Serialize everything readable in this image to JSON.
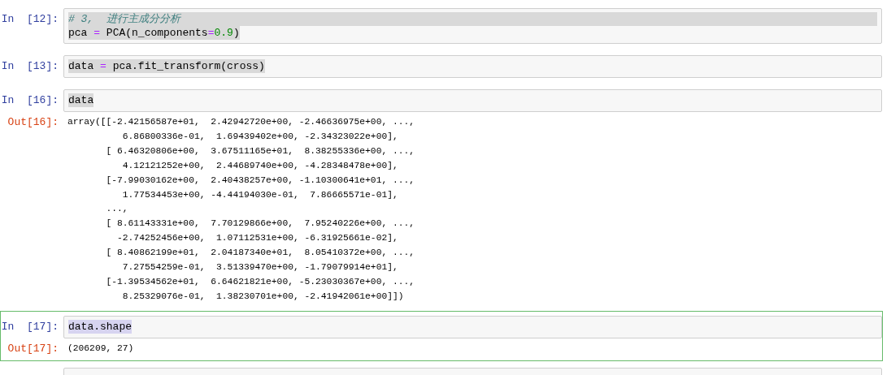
{
  "cells": [
    {
      "prompt": "In  [12]:",
      "selected": false,
      "input": [
        {
          "full_line": true,
          "tokens": [
            {
              "kind": "comment",
              "text": "# 3,  进行主成分分析"
            }
          ]
        },
        {
          "full_line": false,
          "tokens": [
            {
              "kind": "name",
              "text": "pca "
            },
            {
              "kind": "op",
              "text": "="
            },
            {
              "kind": "name",
              "text": " PCA(n_components"
            },
            {
              "kind": "op",
              "text": "="
            },
            {
              "kind": "number",
              "text": "0.9"
            },
            {
              "kind": "name",
              "text": ")"
            }
          ]
        }
      ]
    },
    {
      "prompt": "In  [13]:",
      "selected": false,
      "input": [
        {
          "full_line": false,
          "tokens": [
            {
              "kind": "name",
              "text": "data "
            },
            {
              "kind": "op",
              "text": "="
            },
            {
              "kind": "name",
              "text": " pca.fit_transform(cross)"
            }
          ]
        }
      ]
    },
    {
      "prompt": "In  [16]:",
      "selected": false,
      "input": [
        {
          "full_line": false,
          "tokens": [
            {
              "kind": "name",
              "text": "data"
            }
          ]
        }
      ],
      "output_prompt": "Out[16]:",
      "output": [
        "array([[-2.42156587e+01,  2.42942720e+00, -2.46636975e+00, ...,",
        "          6.86800336e-01,  1.69439402e+00, -2.34323022e+00],",
        "       [ 6.46320806e+00,  3.67511165e+01,  8.38255336e+00, ...,",
        "          4.12121252e+00,  2.44689740e+00, -4.28348478e+00],",
        "       [-7.99030162e+00,  2.40438257e+00, -1.10300641e+01, ...,",
        "          1.77534453e+00, -4.44194030e-01,  7.86665571e-01],",
        "       ...,",
        "       [ 8.61143331e+00,  7.70129866e+00,  7.95240226e+00, ...,",
        "         -2.74252456e+00,  1.07112531e+00, -6.31925661e-02],",
        "       [ 8.40862199e+01,  2.04187340e+01,  8.05410372e+00, ...,",
        "          7.27554259e-01,  3.51339470e+00, -1.79079914e+01],",
        "       [-1.39534562e+01,  6.64621821e+00, -5.23030367e+00, ...,",
        "          8.25329076e-01,  1.38230701e+00, -2.41942061e+00]])"
      ]
    },
    {
      "prompt": "In  [17]:",
      "selected": true,
      "input": [
        {
          "full_line": false,
          "tokens": [
            {
              "kind": "name",
              "text": "data.shape"
            }
          ]
        }
      ],
      "output_prompt": "Out[17]:",
      "output": [
        "(206209, 27)"
      ]
    },
    {
      "selected": false
    }
  ]
}
